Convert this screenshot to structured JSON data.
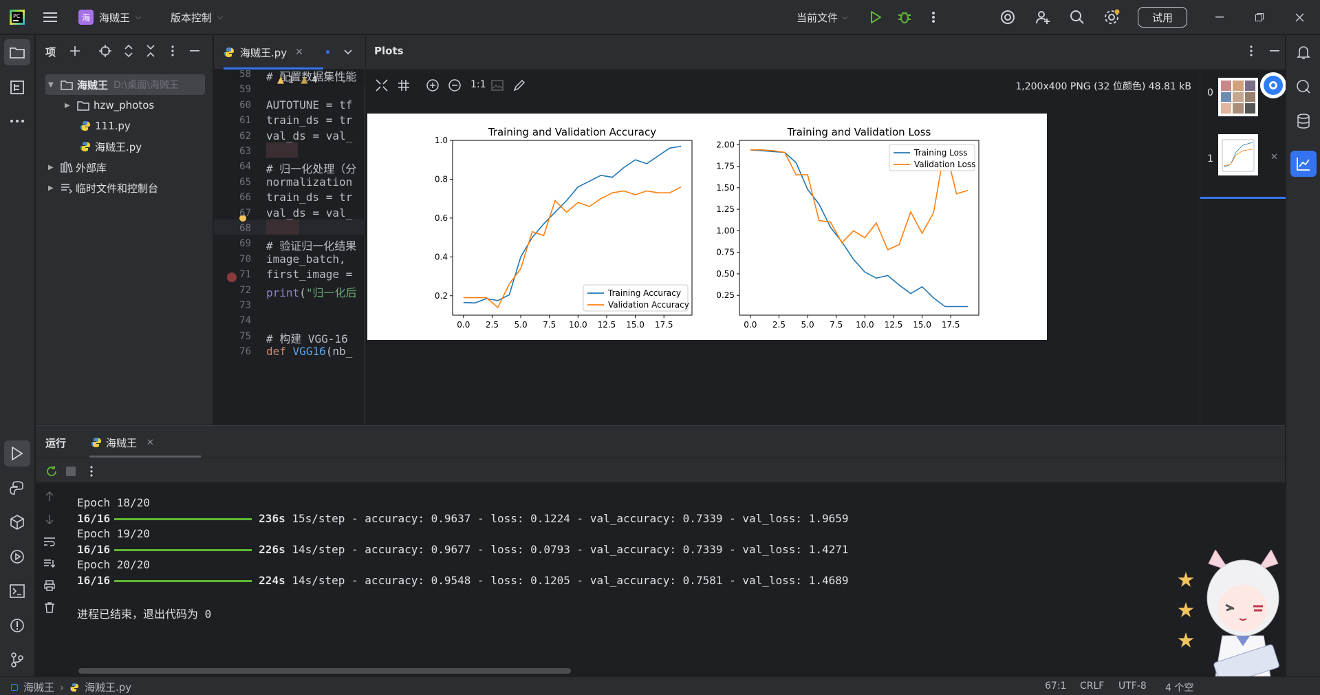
{
  "titlebar": {
    "project_name": "海贼王",
    "project_badge": "海",
    "vcs_label": "版本控制",
    "run_config": "当前文件",
    "trial_button": "试用"
  },
  "project_panel": {
    "title": "项",
    "tree": [
      {
        "label": "海贼王",
        "path": "D:\\桌面\\海贼王",
        "kind": "root-folder"
      },
      {
        "label": "hzw_photos",
        "kind": "folder"
      },
      {
        "label": "111.py",
        "kind": "python"
      },
      {
        "label": "海贼王.py",
        "kind": "python"
      },
      {
        "label": "外部库",
        "kind": "library"
      },
      {
        "label": "临时文件和控制台",
        "kind": "scratch"
      }
    ]
  },
  "editor": {
    "tab_label": "海贼王.py",
    "warnings": {
      "warn": "1",
      "weak": "4"
    },
    "lines": [
      {
        "no": "58",
        "text": "# 配置数据集性能"
      },
      {
        "no": "59",
        "text": ""
      },
      {
        "no": "60",
        "text": "AUTOTUNE = tf"
      },
      {
        "no": "61",
        "text": "train_ds = tr"
      },
      {
        "no": "62",
        "text": "val_ds = val_"
      },
      {
        "no": "63",
        "text": ""
      },
      {
        "no": "64",
        "text": "# 归一化处理（分"
      },
      {
        "no": "65",
        "text": "normalization"
      },
      {
        "no": "66",
        "text": "train_ds = tr"
      },
      {
        "no": "67",
        "text": "val_ds = val_"
      },
      {
        "no": "68",
        "text": ""
      },
      {
        "no": "69",
        "text": "# 验证归一化结果"
      },
      {
        "no": "70",
        "text": "image_batch,"
      },
      {
        "no": "71",
        "text": "first_image ="
      },
      {
        "no": "72",
        "text": "print(\"归一化后"
      },
      {
        "no": "73",
        "text": ""
      },
      {
        "no": "74",
        "text": ""
      },
      {
        "no": "75",
        "text": "# 构建 VGG-16"
      },
      {
        "no": "76",
        "text": "def VGG16(nb_"
      }
    ]
  },
  "plots": {
    "title": "Plots",
    "zoom_label": "1:1",
    "image_info": "1,200x400 PNG (32 位颜色) 48.81 kB",
    "thumb_indices": [
      "0",
      "1"
    ]
  },
  "chart_data": [
    {
      "type": "line",
      "title": "Training and Validation Accuracy",
      "xlim": [
        -0.95,
        19.95
      ],
      "ylim": [
        0.1,
        1.0
      ],
      "xticks": [
        "0.0",
        "2.5",
        "5.0",
        "7.5",
        "10.0",
        "12.5",
        "15.0",
        "17.5"
      ],
      "yticks": [
        "0.2",
        "0.4",
        "0.6",
        "0.8",
        "1.0"
      ],
      "legend_position": "lower right",
      "x": [
        0,
        1,
        2,
        3,
        4,
        5,
        6,
        7,
        8,
        9,
        10,
        11,
        12,
        13,
        14,
        15,
        16,
        17,
        18,
        19
      ],
      "series": [
        {
          "name": "Training Accuracy",
          "color": "#1f77b4",
          "values": [
            0.165,
            0.163,
            0.185,
            0.175,
            0.205,
            0.4,
            0.5,
            0.57,
            0.63,
            0.69,
            0.76,
            0.79,
            0.82,
            0.81,
            0.86,
            0.9,
            0.88,
            0.92,
            0.96,
            0.97
          ]
        },
        {
          "name": "Validation Accuracy",
          "color": "#ff7f0e",
          "values": [
            0.19,
            0.19,
            0.19,
            0.14,
            0.26,
            0.34,
            0.53,
            0.51,
            0.69,
            0.63,
            0.68,
            0.66,
            0.7,
            0.73,
            0.74,
            0.72,
            0.74,
            0.73,
            0.73,
            0.76
          ]
        }
      ]
    },
    {
      "type": "line",
      "title": "Training and Validation Loss",
      "xlim": [
        -0.95,
        19.95
      ],
      "ylim": [
        0.02,
        2.05
      ],
      "xticks": [
        "0.0",
        "2.5",
        "5.0",
        "7.5",
        "10.0",
        "12.5",
        "15.0",
        "17.5"
      ],
      "yticks": [
        "0.25",
        "0.50",
        "0.75",
        "1.00",
        "1.25",
        "1.50",
        "1.75",
        "2.00"
      ],
      "legend_position": "upper right",
      "x": [
        0,
        1,
        2,
        3,
        4,
        5,
        6,
        7,
        8,
        9,
        10,
        11,
        12,
        13,
        14,
        15,
        16,
        17,
        18,
        19
      ],
      "series": [
        {
          "name": "Training Loss",
          "color": "#1f77b4",
          "values": [
            1.94,
            1.93,
            1.92,
            1.91,
            1.79,
            1.48,
            1.31,
            1.04,
            0.87,
            0.67,
            0.52,
            0.45,
            0.48,
            0.37,
            0.27,
            0.35,
            0.22,
            0.12,
            0.12,
            0.12
          ]
        },
        {
          "name": "Validation Loss",
          "color": "#ff7f0e",
          "values": [
            1.94,
            1.94,
            1.93,
            1.91,
            1.65,
            1.65,
            1.12,
            1.1,
            0.86,
            1.0,
            0.92,
            1.09,
            0.78,
            0.84,
            1.22,
            0.97,
            1.21,
            1.98,
            1.43,
            1.47
          ]
        }
      ]
    }
  ],
  "run_panel": {
    "title": "运行",
    "tab_label": "海贼王",
    "output": [
      {
        "type": "epoch",
        "text": "Epoch 18/20"
      },
      {
        "type": "progress",
        "steps": "16/16",
        "time": "236s",
        "detail": "15s/step - accuracy: 0.9637 - loss: 0.1224 - val_accuracy: 0.7339 - val_loss: 1.9659"
      },
      {
        "type": "epoch",
        "text": "Epoch 19/20"
      },
      {
        "type": "progress",
        "steps": "16/16",
        "time": "226s",
        "detail": "14s/step - accuracy: 0.9677 - loss: 0.0793 - val_accuracy: 0.7339 - val_loss: 1.4271"
      },
      {
        "type": "epoch",
        "text": "Epoch 20/20"
      },
      {
        "type": "progress",
        "steps": "16/16",
        "time": "224s",
        "detail": "14s/step - accuracy: 0.9548 - loss: 0.1205 - val_accuracy: 0.7581 - val_loss: 1.4689"
      },
      {
        "type": "exit",
        "text": "进程已结束，退出代码为 0"
      }
    ]
  },
  "statusbar": {
    "breadcrumb_project": "海贼王",
    "breadcrumb_file": "海贼王.py",
    "position": "67:1",
    "line_sep": "CRLF",
    "encoding": "UTF-8",
    "indent": "4 个空"
  },
  "colors": {
    "accent": "#3574f0",
    "run_green": "#5fb832",
    "series_blue": "#1f77b4",
    "series_orange": "#ff7f0e"
  },
  "icons": [
    "pycharm-logo-icon",
    "hamburger-menu-icon",
    "run-icon",
    "debug-icon",
    "more-icon",
    "ai-assistant-icon",
    "add-user-icon",
    "search-icon",
    "settings-icon",
    "folder-icon",
    "structure-icon",
    "python-file-icon",
    "bell-icon",
    "database-icon",
    "plots-icon",
    "rerun-icon",
    "stop-icon",
    "python-console-icon",
    "services-icon",
    "terminal-icon",
    "problems-icon",
    "git-icon"
  ]
}
